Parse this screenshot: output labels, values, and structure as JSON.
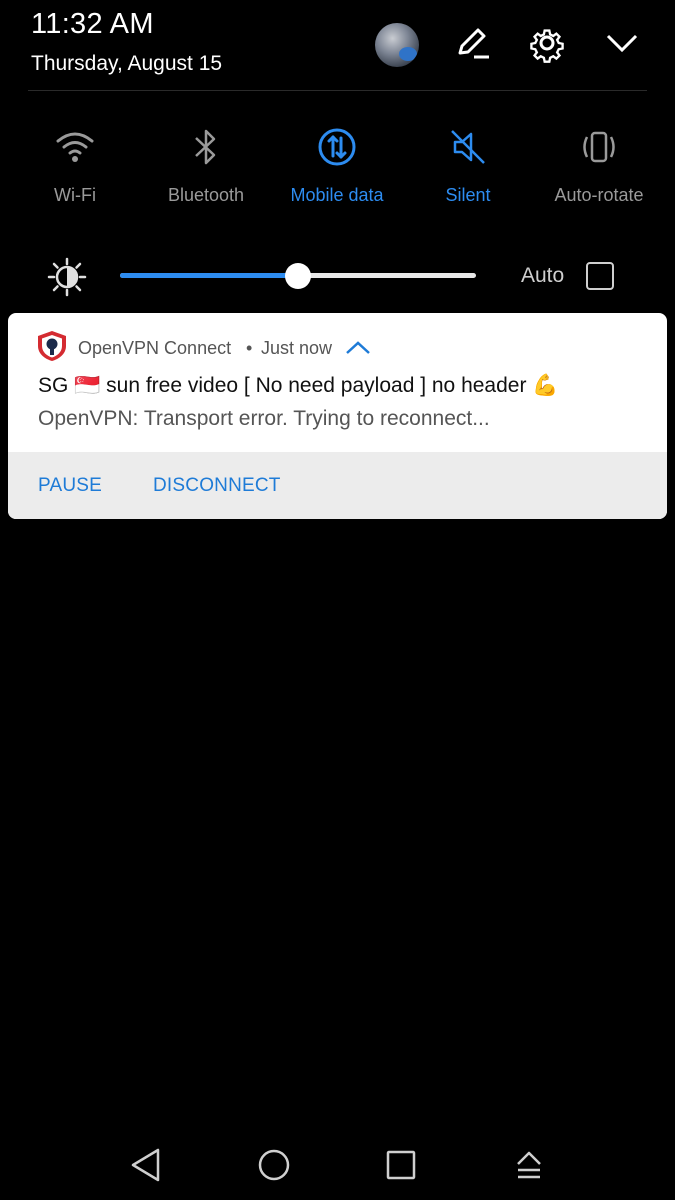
{
  "status": {
    "time": "11:32 AM",
    "date": "Thursday, August 15"
  },
  "header_icons": [
    "avatar",
    "edit-icon",
    "settings-icon",
    "chevron-down-icon"
  ],
  "toggles": [
    {
      "label": "Wi-Fi",
      "icon": "wifi-icon",
      "active": false
    },
    {
      "label": "Bluetooth",
      "icon": "bluetooth-icon",
      "active": false
    },
    {
      "label": "Mobile data",
      "icon": "mobile-data-icon",
      "active": true
    },
    {
      "label": "Silent",
      "icon": "silent-icon",
      "active": true
    },
    {
      "label": "Auto-rotate",
      "icon": "auto-rotate-icon",
      "active": false
    }
  ],
  "brightness": {
    "level_percent": 50,
    "auto_label": "Auto",
    "auto_checked": false
  },
  "notification": {
    "app_name": "OpenVPN Connect",
    "separator": "•",
    "time": "Just now",
    "title": "SG 🇸🇬 sun free video [ No need payload ] no header 💪",
    "text": "OpenVPN: Transport error. Trying to reconnect...",
    "actions": {
      "pause": "PAUSE",
      "disconnect": "DISCONNECT"
    }
  },
  "navbar": [
    "back-icon",
    "home-icon",
    "recents-icon",
    "notification-manage-icon"
  ],
  "colors": {
    "accent": "#2d8cf0",
    "inactive": "#9a9a9a",
    "background": "#000000",
    "card": "#ffffff",
    "action_bar": "#ececec",
    "openvpn_red": "#d42b31"
  }
}
